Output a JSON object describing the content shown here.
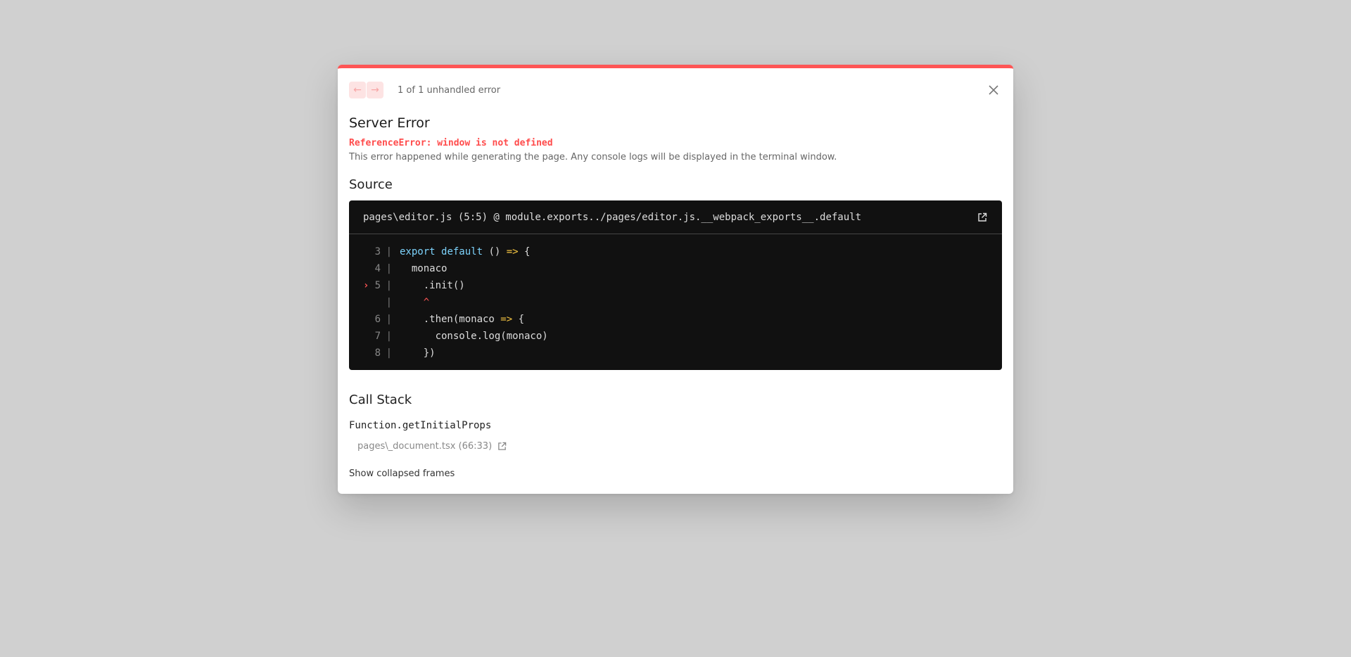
{
  "header": {
    "prev_label": "←",
    "next_label": "→",
    "error_count": "1 of 1 unhandled error"
  },
  "error": {
    "title": "Server Error",
    "message": "ReferenceError: window is not defined",
    "description": "This error happened while generating the page. Any console logs will be displayed in the terminal window."
  },
  "source": {
    "title": "Source",
    "file_ref": "pages\\editor.js (5:5) @ module.exports../pages/editor.js.__webpack_exports__.default",
    "lines": [
      {
        "no": "3",
        "parts": [
          {
            "t": "export",
            "c": "kw"
          },
          {
            "t": " "
          },
          {
            "t": "default",
            "c": "kw"
          },
          {
            "t": " () "
          },
          {
            "t": "=>",
            "c": "op"
          },
          {
            "t": " {"
          }
        ]
      },
      {
        "no": "4",
        "parts": [
          {
            "t": "  monaco"
          }
        ]
      },
      {
        "no": "5",
        "marker": "›",
        "parts": [
          {
            "t": "    .init()"
          }
        ]
      },
      {
        "no": "",
        "parts": [
          {
            "t": "    "
          },
          {
            "t": "^",
            "c": "caret"
          }
        ]
      },
      {
        "no": "6",
        "parts": [
          {
            "t": "    .then(monaco "
          },
          {
            "t": "=>",
            "c": "op"
          },
          {
            "t": " {"
          }
        ]
      },
      {
        "no": "7",
        "parts": [
          {
            "t": "      console.log(monaco)"
          }
        ]
      },
      {
        "no": "8",
        "parts": [
          {
            "t": "    })"
          }
        ]
      }
    ]
  },
  "call_stack": {
    "title": "Call Stack",
    "frames": [
      {
        "function": "Function.getInitialProps",
        "location": "pages\\_document.tsx (66:33)"
      }
    ],
    "show_collapsed_label": "Show collapsed frames"
  },
  "colors": {
    "accent": "#ff5555",
    "overlay": "#d0d0d0",
    "code_bg": "#111111"
  }
}
